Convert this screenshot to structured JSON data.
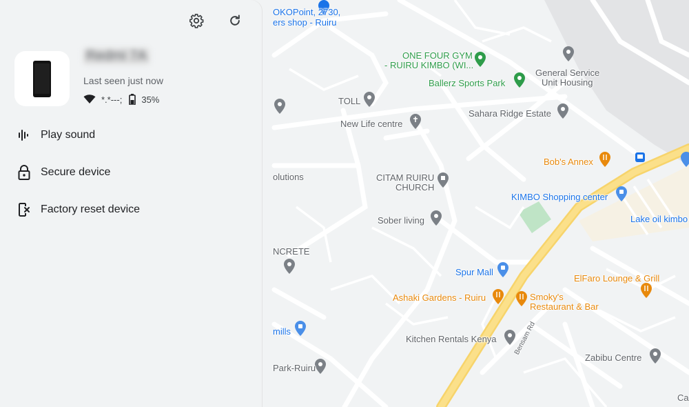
{
  "panel": {
    "device_name": "Redmi 7A",
    "last_seen": "Last seen just now",
    "network": "*.*---;",
    "battery": "35%",
    "actions": [
      {
        "label": "Play sound",
        "icon": "sound-wave-icon"
      },
      {
        "label": "Secure device",
        "icon": "lock-icon"
      },
      {
        "label": "Factory reset device",
        "icon": "phone-erase-icon"
      }
    ]
  },
  "colors": {
    "map_bg": "#f1f3f4",
    "road": "#ffffff",
    "highway": "#fbd96f",
    "poi_green": "#2e9c4a",
    "poi_orange": "#e8890c",
    "poi_blue": "#1a73e8",
    "poi_gray": "#5f6368"
  },
  "map": {
    "labels": [
      {
        "text": "OKOPoint, 2730,",
        "color": "blue"
      },
      {
        "text": "ers shop - Ruiru",
        "color": "blue"
      },
      {
        "text": "ONE FOUR GYM",
        "color": "green"
      },
      {
        "text": "- RUIRU KIMBO (WI...",
        "color": "green"
      },
      {
        "text": "Ballerz Sports Park",
        "color": "green"
      },
      {
        "text": "General Service",
        "color": "gray"
      },
      {
        "text": "Unit Housing",
        "color": "gray"
      },
      {
        "text": "TOLL",
        "color": "gray"
      },
      {
        "text": "New Life centre",
        "color": "gray"
      },
      {
        "text": "Sahara Ridge Estate",
        "color": "gray"
      },
      {
        "text": "Bob's Annex",
        "color": "orange"
      },
      {
        "text": "olutions",
        "color": "gray"
      },
      {
        "text": "CITAM RUIRU",
        "color": "gray"
      },
      {
        "text": "CHURCH",
        "color": "gray"
      },
      {
        "text": "KIMBO Shopping center",
        "color": "blue"
      },
      {
        "text": "Lake oil kimbo",
        "color": "blue"
      },
      {
        "text": "Sober living",
        "color": "gray"
      },
      {
        "text": "NCRETE",
        "color": "gray"
      },
      {
        "text": "Spur Mall",
        "color": "blue"
      },
      {
        "text": "ElFaro Lounge & Grill",
        "color": "orange"
      },
      {
        "text": "Ashaki Gardens - Ruiru",
        "color": "orange"
      },
      {
        "text": "Smoky's",
        "color": "orange"
      },
      {
        "text": "Restaurant & Bar",
        "color": "orange"
      },
      {
        "text": "mills",
        "color": "blue"
      },
      {
        "text": "Kitchen Rentals Kenya",
        "color": "gray"
      },
      {
        "text": "Bensam Rd",
        "color": "gray"
      },
      {
        "text": "Zabibu Centre",
        "color": "gray"
      },
      {
        "text": "Park-Ruiru",
        "color": "gray"
      },
      {
        "text": "Ca",
        "color": "gray"
      }
    ]
  }
}
